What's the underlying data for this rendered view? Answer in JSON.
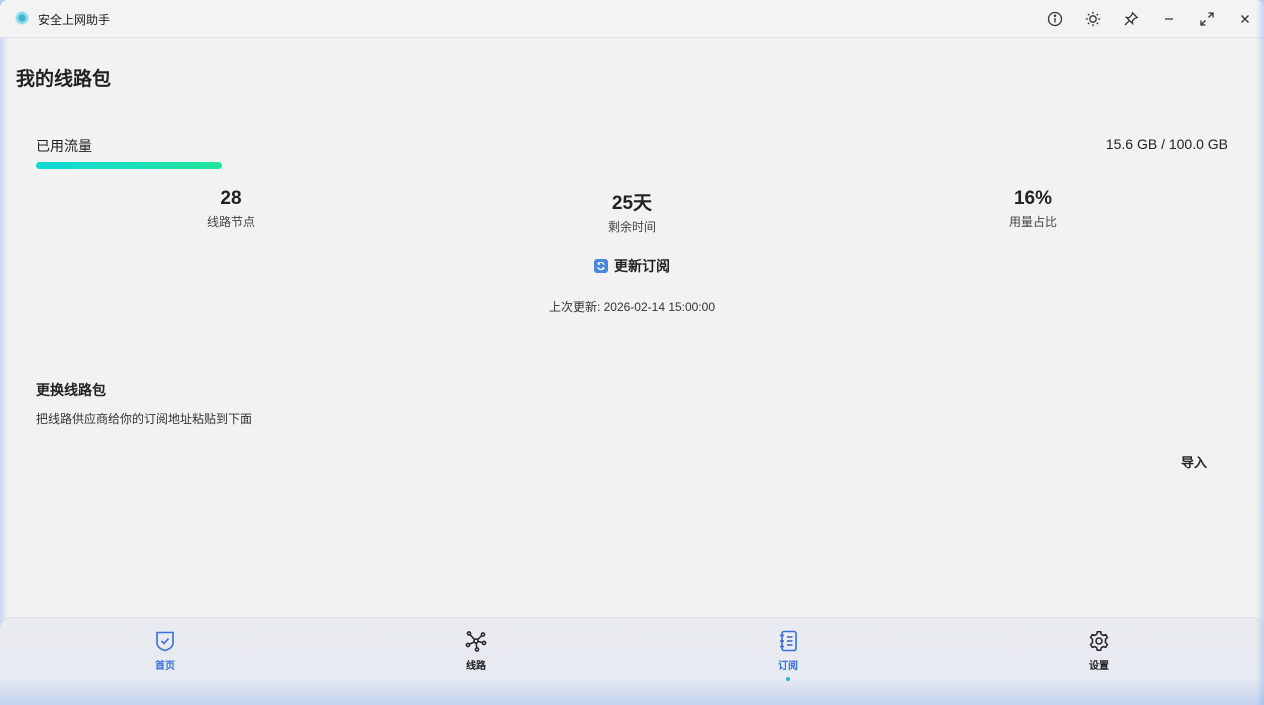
{
  "window": {
    "title": "安全上网助手"
  },
  "page": {
    "title": "我的线路包"
  },
  "traffic": {
    "label": "已用流量",
    "value": "15.6 GB / 100.0 GB",
    "fraction": 0.156
  },
  "stats": [
    {
      "value": "28",
      "label": "线路节点"
    },
    {
      "value": "25天",
      "label": "剩余时间"
    },
    {
      "value": "16%",
      "label": "用量占比"
    }
  ],
  "refresh": {
    "label": "更新订阅",
    "last_update": "上次更新: 2026-02-14 15:00:00"
  },
  "switch_section": {
    "title": "更换线路包",
    "description": "把线路供应商给你的订阅地址粘贴到下面",
    "import_label": "导入"
  },
  "nav": {
    "items": [
      {
        "label": "首页",
        "icon": "shield-check-icon"
      },
      {
        "label": "线路",
        "icon": "nodes-icon"
      },
      {
        "label": "订阅",
        "icon": "notebook-icon",
        "active": true
      },
      {
        "label": "设置",
        "icon": "gear-icon"
      }
    ]
  },
  "colors": {
    "accent": "#3a6fd8",
    "progress_start": "#0fd9d6",
    "progress_end": "#22e59a",
    "active_dot": "#2bb3e0"
  }
}
